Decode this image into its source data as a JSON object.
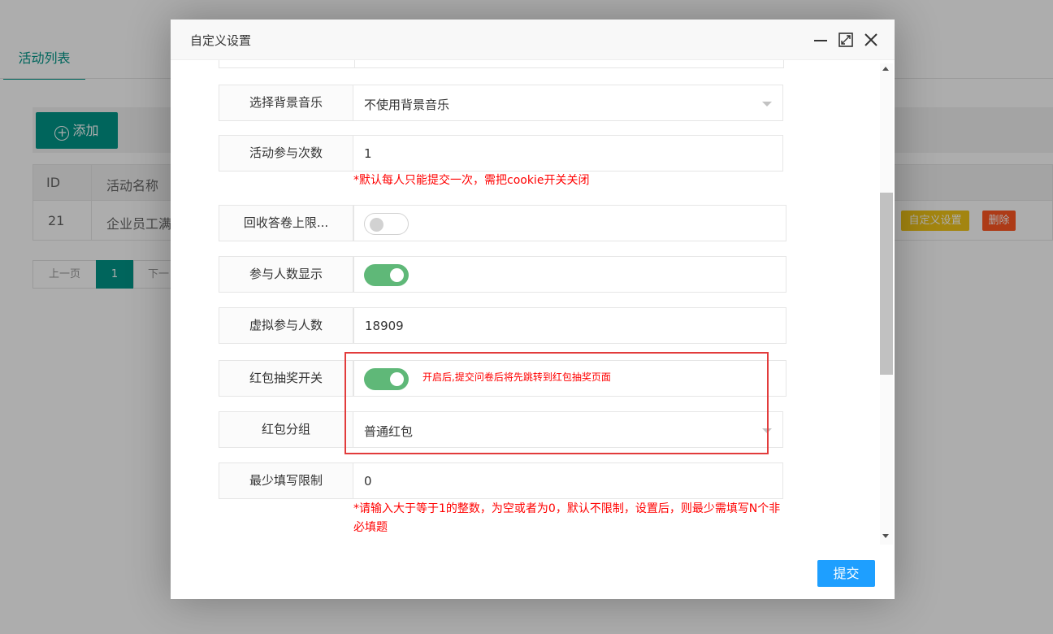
{
  "background": {
    "tab_label": "活动列表",
    "add_button": "添加",
    "table": {
      "headers": [
        "ID",
        "活动名称"
      ],
      "rows": [
        {
          "id": "21",
          "name": "企业员工满"
        }
      ],
      "custom_button": "自定义设置",
      "delete_button": "删除"
    },
    "pager": {
      "prev": "上一页",
      "current": "1",
      "next": "下一"
    }
  },
  "modal": {
    "title": "自定义设置",
    "fields": {
      "bgm": {
        "label": "选择背景音乐",
        "value": "不使用背景音乐"
      },
      "participate_times": {
        "label": "活动参与次数",
        "value": "1",
        "hint": "*默认每人只能提交一次，需把cookie开关关闭"
      },
      "recycle_limit": {
        "label": "回收答卷上限...",
        "toggle": "off"
      },
      "show_participants": {
        "label": "参与人数显示",
        "toggle": "on"
      },
      "virtual_participants": {
        "label": "虚拟参与人数",
        "value": "18909"
      },
      "red_packet_switch": {
        "label": "红包抽奖开关",
        "toggle": "on",
        "hint": "开启后,提交问卷后将先跳转到红包抽奖页面"
      },
      "red_packet_group": {
        "label": "红包分组",
        "value": "普通红包"
      },
      "min_fill": {
        "label": "最少填写限制",
        "value": "0",
        "hint": "*请输入大于等于1的整数，为空或者为0，默认不限制，设置后，则最少需填写N个非必填题"
      }
    },
    "submit_button": "提交"
  },
  "colors": {
    "accent": "#009688",
    "toggle_on": "#5fb878",
    "submit": "#1e9fff",
    "hint": "#ff0000",
    "highlight_box": "#e23c3c"
  }
}
